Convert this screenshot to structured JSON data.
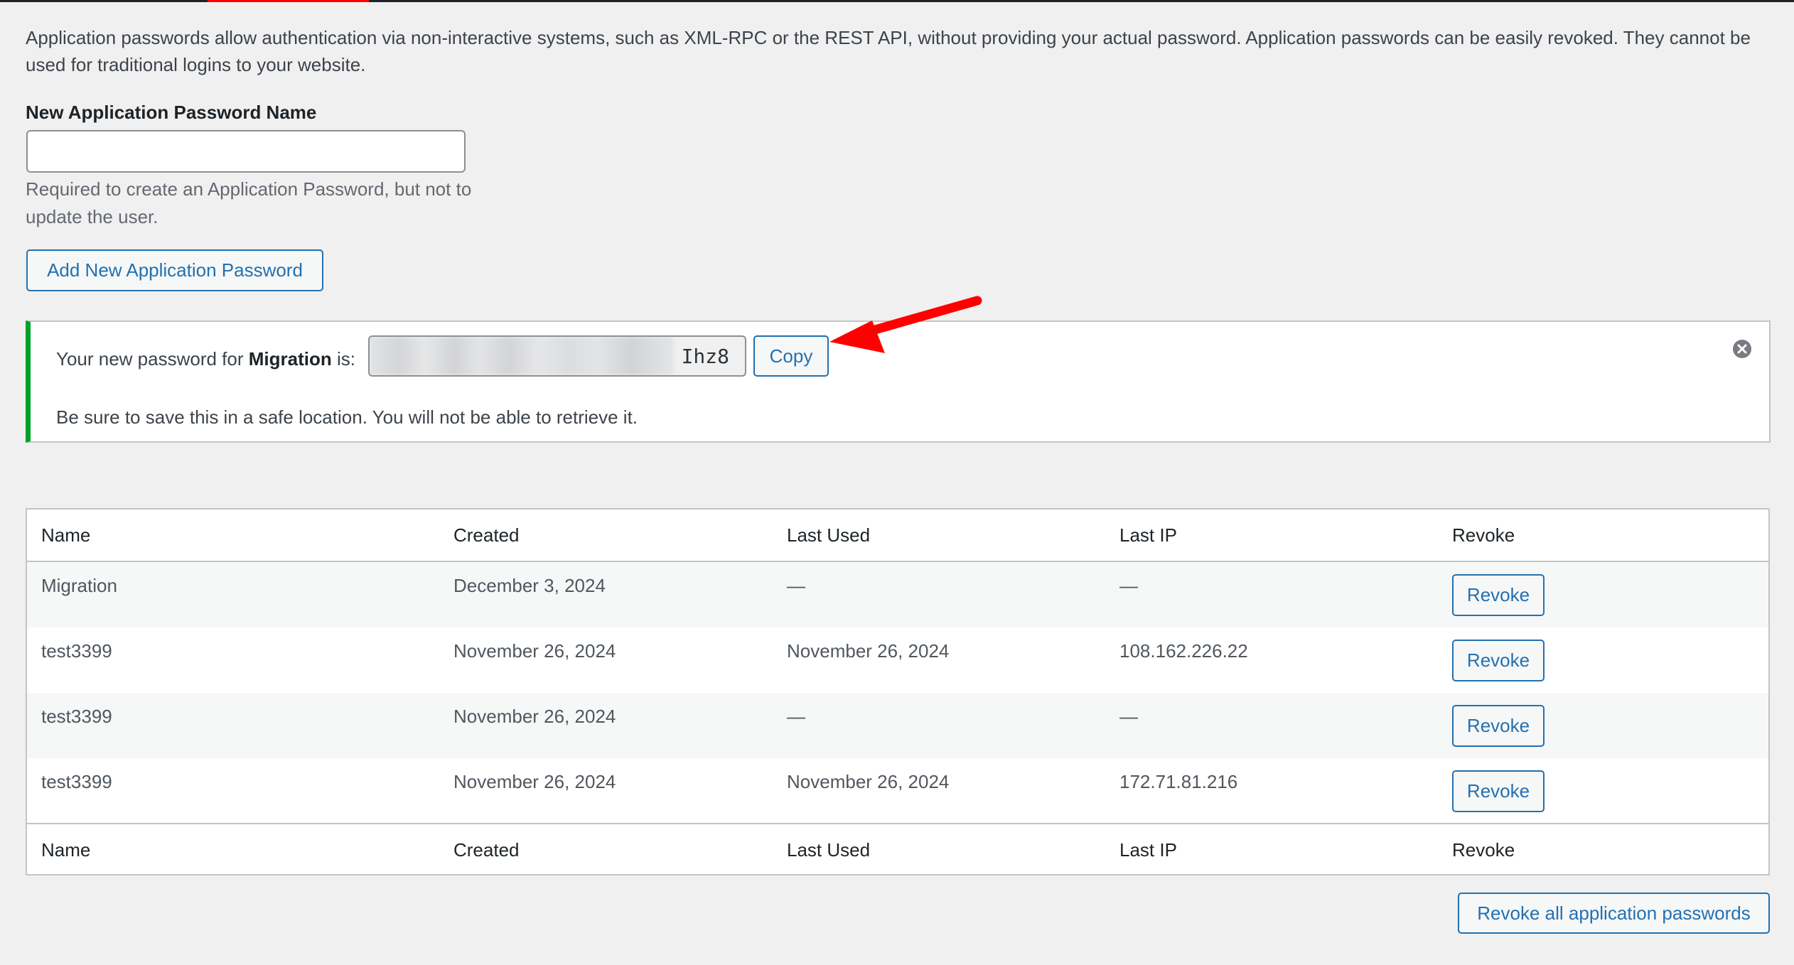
{
  "intro": {
    "text": "Application passwords allow authentication via non-interactive systems, such as XML-RPC or the REST API, without providing your actual password. Application passwords can be easily revoked. They cannot be used for traditional logins to your website."
  },
  "new_password": {
    "label": "New Application Password Name",
    "value": "",
    "placeholder": "",
    "description": "Required to create an Application Password, but not to update the user.",
    "add_button_label": "Add New Application Password"
  },
  "notice": {
    "prefix": "Your new password for ",
    "app_name": "Migration",
    "suffix": " is:",
    "password_visible_tail": "Ihz8",
    "copy_button_label": "Copy",
    "warning": "Be sure to save this in a safe location. You will not be able to retrieve it.",
    "dismiss_icon": "dismiss-icon",
    "accent_color": "#00a32a"
  },
  "annotation": {
    "type": "arrow",
    "color": "#ff0000",
    "points_to": "copy-button"
  },
  "table": {
    "columns": [
      "Name",
      "Created",
      "Last Used",
      "Last IP",
      "Revoke"
    ],
    "rows": [
      {
        "name": "Migration",
        "created": "December 3, 2024",
        "last_used": "—",
        "last_ip": "—",
        "action": "Revoke"
      },
      {
        "name": "test3399",
        "created": "November 26, 2024",
        "last_used": "November 26, 2024",
        "last_ip": "108.162.226.22",
        "action": "Revoke"
      },
      {
        "name": "test3399",
        "created": "November 26, 2024",
        "last_used": "—",
        "last_ip": "—",
        "action": "Revoke"
      },
      {
        "name": "test3399",
        "created": "November 26, 2024",
        "last_used": "November 26, 2024",
        "last_ip": "172.71.81.216",
        "action": "Revoke"
      }
    ]
  },
  "revoke_all_label": "Revoke all application passwords",
  "colors": {
    "link_blue": "#2271b1",
    "background": "#f0f0f1",
    "topbar": "#1d2327",
    "topbar_accent": "#ff0000"
  }
}
